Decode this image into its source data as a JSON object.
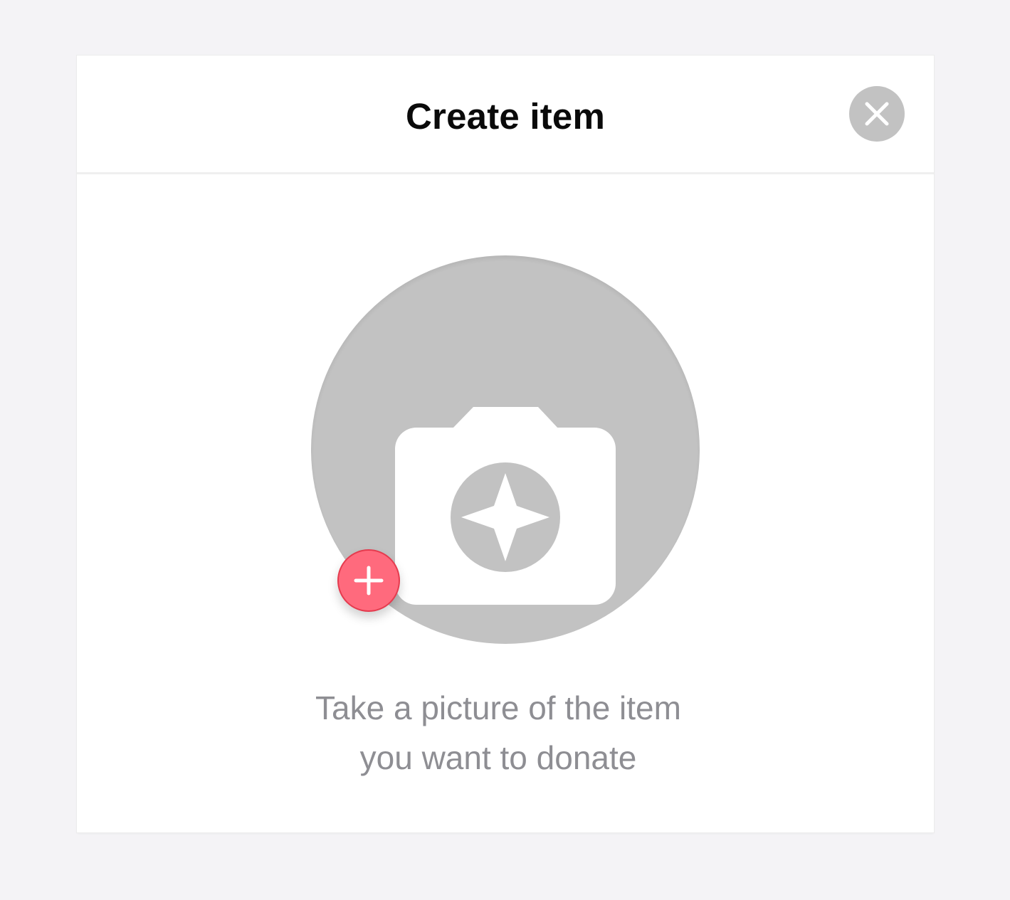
{
  "modal": {
    "title": "Create item",
    "close_icon": "close-icon",
    "photo_placeholder_icon": "camera-icon",
    "add_icon": "plus-icon",
    "instruction_line1": "Take a picture of the item",
    "instruction_line2": "you want to donate"
  },
  "colors": {
    "background": "#f4f3f6",
    "card": "#ffffff",
    "placeholder_gray": "#c2c2c2",
    "accent_add": "#ff6a7d",
    "accent_add_border": "#e53b4e",
    "instruction_text": "#8e8e93",
    "title_text": "#0a0a0a"
  }
}
